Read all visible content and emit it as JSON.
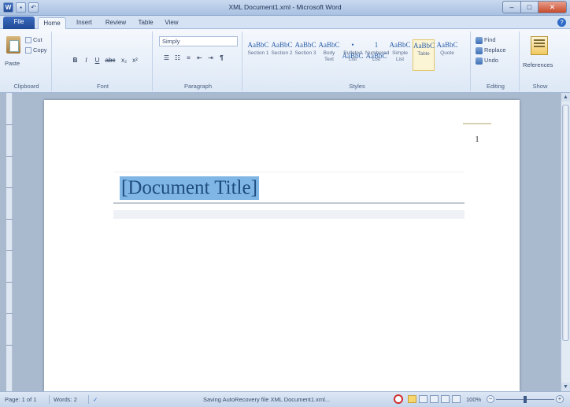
{
  "window": {
    "title": "XML Document1.xml - Microsoft Word",
    "minimize": "–",
    "maximize": "□",
    "close": "✕"
  },
  "qat": {
    "app": "W",
    "save": "▪",
    "undo": "↶"
  },
  "tabs": [
    {
      "label": "File"
    },
    {
      "label": "Home"
    },
    {
      "label": "Insert"
    },
    {
      "label": "Review"
    },
    {
      "label": "Table"
    },
    {
      "label": "View"
    }
  ],
  "help": "?",
  "ribbon": {
    "clipboard": {
      "paste": "Paste",
      "cut": "Cut",
      "copy": "Copy",
      "label": "Clipboard"
    },
    "font": {
      "bold": "B",
      "italic": "I",
      "underline": "U",
      "strike": "abc",
      "sub": "x₂",
      "sup": "x²",
      "label": "Font"
    },
    "paragraph": {
      "style_value": "Simply",
      "bullets": "☰",
      "numbering": "☷",
      "align": "≡",
      "indent_dec": "⇤",
      "indent_inc": "⇥",
      "pilcrow": "¶",
      "label": "Paragraph"
    },
    "styles": {
      "tiles": [
        {
          "sample": "AaBbC",
          "name": "Section 1"
        },
        {
          "sample": "AaBbC",
          "name": "Section 2"
        },
        {
          "sample": "AaBbC",
          "name": "Section 3"
        },
        {
          "sample": "AaBbC",
          "name": "Body Text"
        },
        {
          "sample": "• AaBbC",
          "name": "Bulleted List"
        },
        {
          "sample": "1 AaBbC",
          "name": "Numbered List"
        },
        {
          "sample": "AaBbC",
          "name": "Simple List"
        },
        {
          "sample": "AaBbC",
          "name": "Table"
        },
        {
          "sample": "AaBbC",
          "name": "Quote"
        }
      ],
      "label": "Styles"
    },
    "editing": {
      "find": "Find",
      "replace": "Replace",
      "undo": "Undo",
      "label": "Editing"
    },
    "show": {
      "references": "References",
      "label": "Show"
    }
  },
  "document": {
    "page_number": "1",
    "title": "[Document Title]"
  },
  "status": {
    "page": "Page: 1 of 1",
    "words": "Words: 2",
    "message": "Saving AutoRecovery file XML Document1.xml...",
    "zoom": "100%",
    "zoom_out": "−",
    "zoom_in": "+"
  }
}
